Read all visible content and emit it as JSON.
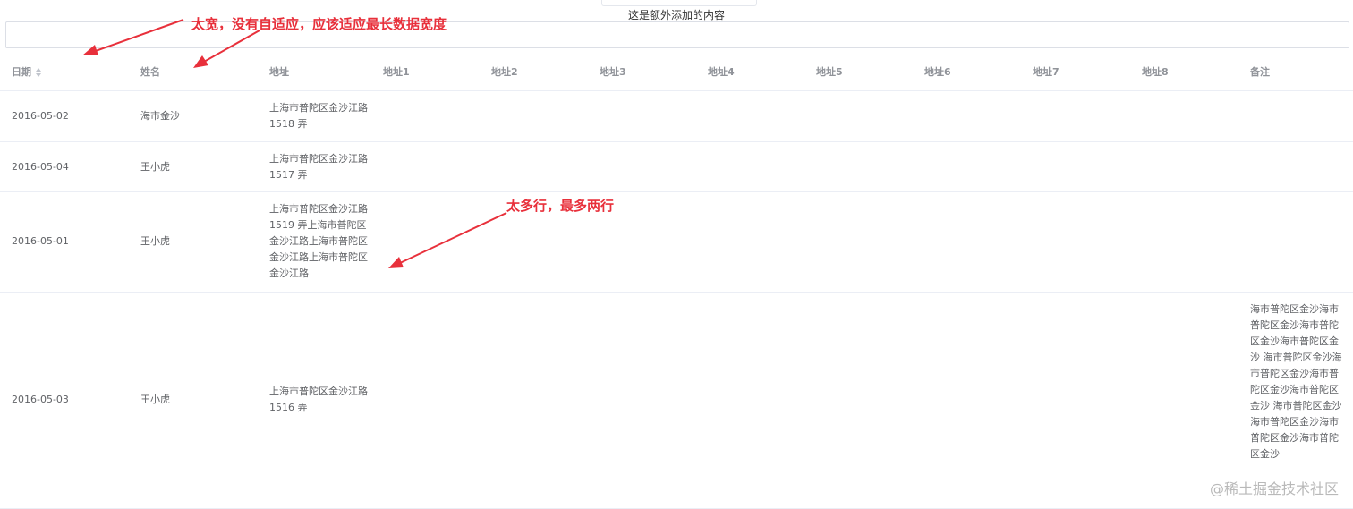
{
  "extra_content": "这是额外添加的内容",
  "search_input": {
    "value": ""
  },
  "columns": [
    {
      "key": "date",
      "label": "日期",
      "sortable": true
    },
    {
      "key": "name",
      "label": "姓名"
    },
    {
      "key": "address",
      "label": "地址"
    },
    {
      "key": "address1",
      "label": "地址1"
    },
    {
      "key": "address2",
      "label": "地址2"
    },
    {
      "key": "address3",
      "label": "地址3"
    },
    {
      "key": "address4",
      "label": "地址4"
    },
    {
      "key": "address5",
      "label": "地址5"
    },
    {
      "key": "address6",
      "label": "地址6"
    },
    {
      "key": "address7",
      "label": "地址7"
    },
    {
      "key": "address8",
      "label": "地址8"
    },
    {
      "key": "remark",
      "label": "备注"
    }
  ],
  "rows": [
    {
      "date": "2016-05-02",
      "name": "海市金沙",
      "address": "上海市普陀区金沙江路 1518 弄",
      "remark": ""
    },
    {
      "date": "2016-05-04",
      "name": "王小虎",
      "address": "上海市普陀区金沙江路 1517 弄",
      "remark": ""
    },
    {
      "date": "2016-05-01",
      "name": "王小虎",
      "address": "上海市普陀区金沙江路 1519 弄上海市普陀区金沙江路上海市普陀区金沙江路上海市普陀区金沙江路",
      "remark": ""
    },
    {
      "date": "2016-05-03",
      "name": "王小虎",
      "address": "上海市普陀区金沙江路 1516 弄",
      "remark": "海市普陀区金沙海市普陀区金沙海市普陀区金沙海市普陀区金沙 海市普陀区金沙海市普陀区金沙海市普陀区金沙海市普陀区金沙 海市普陀区金沙海市普陀区金沙海市普陀区金沙海市普陀区金沙"
    }
  ],
  "annotations": {
    "too_wide": "太宽，没有自适应，应该适应最长数据宽度",
    "too_many_lines": "太多行，最多两行"
  },
  "watermark": "@稀土掘金技术社区",
  "colors": {
    "annotation": "#e8303b",
    "header_text": "#909399",
    "cell_text": "#606266",
    "border": "#ebeef5"
  }
}
